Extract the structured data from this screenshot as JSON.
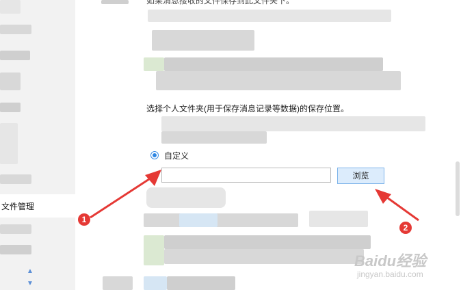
{
  "sidebar": {
    "active_item": "文件管理"
  },
  "main": {
    "top_text": "如果消息接收的文件保存到此文件夹下。",
    "folder_hint": "选择个人文件夹(用于保存消息记录等数据)的保存位置。",
    "custom_label": "自定义",
    "path_value": "",
    "browse_label": "浏览"
  },
  "annotations": {
    "badge_1": "1",
    "badge_2": "2",
    "color": "#e53935"
  },
  "watermark": {
    "logo": "Baidu经验",
    "url": "jingyan.baidu.com"
  }
}
